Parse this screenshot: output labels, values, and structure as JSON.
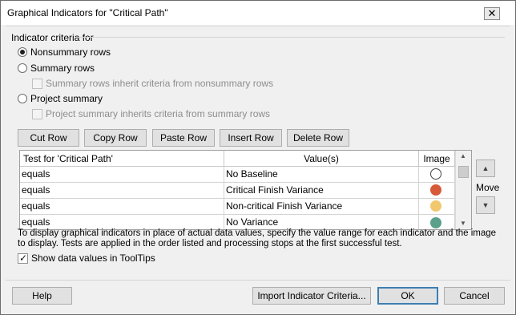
{
  "window": {
    "title": "Graphical Indicators for \"Critical Path\"",
    "close_glyph": "✕"
  },
  "criteria": {
    "group_label": "Indicator criteria for",
    "nonsummary_label": "Nonsummary rows",
    "summary_label": "Summary rows",
    "summary_inherit_label": "Summary rows inherit criteria from nonsummary rows",
    "project_summary_label": "Project summary",
    "project_inherit_label": "Project summary inherits criteria from summary rows",
    "selected": "Nonsummary rows"
  },
  "toolbar": {
    "cut_row": "Cut Row",
    "copy_row": "Copy Row",
    "paste_row": "Paste Row",
    "insert_row": "Insert Row",
    "delete_row": "Delete Row"
  },
  "table": {
    "headers": [
      "Test for 'Critical Path'",
      "Value(s)",
      "Image"
    ],
    "rows": [
      {
        "test": "equals",
        "value": "No Baseline",
        "image": "empty-circle",
        "color": "#ffffff"
      },
      {
        "test": "equals",
        "value": "Critical Finish Variance",
        "image": "red-circle",
        "color": "#d65a3a"
      },
      {
        "test": "equals",
        "value": "Non-critical Finish Variance",
        "image": "yellow-circle",
        "color": "#f1c86e"
      },
      {
        "test": "equals",
        "value": "No Variance",
        "image": "green-circle",
        "color": "#5ba08a"
      }
    ]
  },
  "move": {
    "label": "Move",
    "up_icon": "▲",
    "down_icon": "▼"
  },
  "info_text": "To display graphical indicators in place of actual data values, specify the value range for each indicator and the image to display.  Tests are applied in the order listed and processing stops at the first successful test.",
  "show_values_label": "Show data values in ToolTips",
  "show_values_checked": true,
  "footer": {
    "help": "Help",
    "import": "Import Indicator Criteria...",
    "ok": "OK",
    "cancel": "Cancel"
  }
}
